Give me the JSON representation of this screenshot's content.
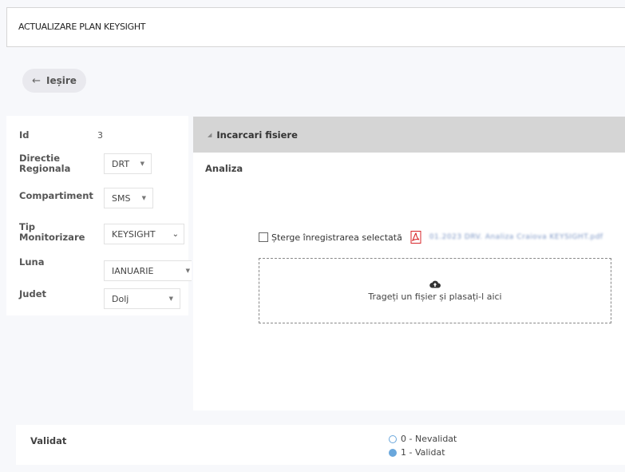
{
  "header": {
    "title": "ACTUALIZARE PLAN KEYSIGHT"
  },
  "back_button": {
    "arrow": "←",
    "label": "Ieșire"
  },
  "form": {
    "id_label": "Id",
    "id_value": "3",
    "directie_label": "Directie Regionala",
    "directie_value": "DRT",
    "compartiment_label": "Compartiment",
    "compartiment_value": "SMS",
    "tip_label": "Tip Monitorizare",
    "tip_value": "KEYSIGHT",
    "luna_label": "Luna",
    "luna_value": "IANUARIE",
    "judet_label": "Judet",
    "judet_value": "Dolj"
  },
  "upload_section": {
    "title": "Incarcari fisiere",
    "analiza_label": "Analiza",
    "delete_label": "Șterge înregistrarea selectată",
    "file_link": "01.2023 DRV. Analiza Craiova KEYSIGHT.pdf",
    "dropzone_text": "Trageți un fișier și plasați-l aici"
  },
  "validat": {
    "label": "Validat",
    "options": [
      {
        "label": "0 - Nevalidat",
        "selected": false
      },
      {
        "label": "1 - Validat",
        "selected": true
      }
    ]
  },
  "colors": {
    "section_bar": "#d5d5d5",
    "radio_accent": "#6aa7dc",
    "pdf_red": "#d8262a"
  },
  "icons": {
    "back": "arrow-left-icon",
    "section": "triangle-collapse-icon",
    "pdf": "pdf-file-icon",
    "upload": "cloud-upload-icon",
    "dropdown": "caret-down-icon"
  }
}
